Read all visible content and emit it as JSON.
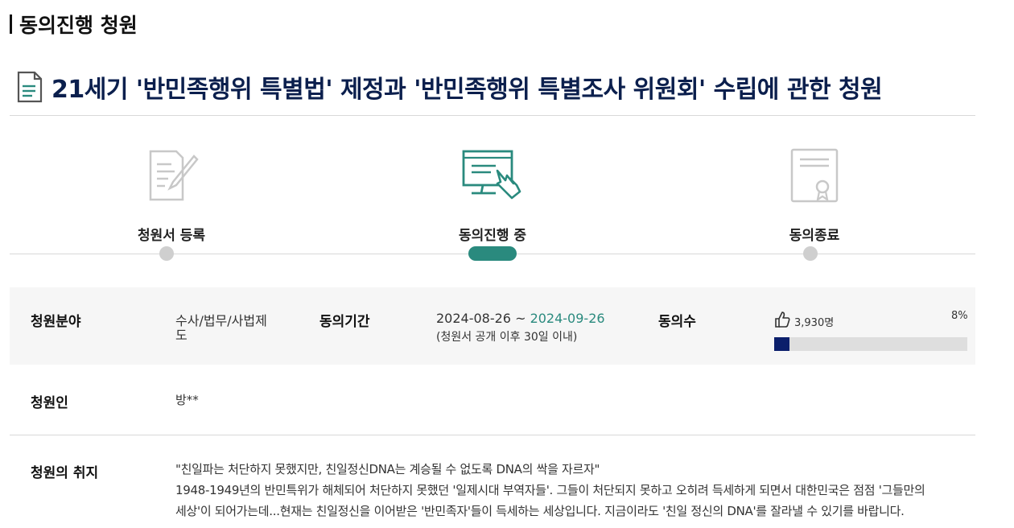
{
  "section": {
    "title": "동의진행 청원"
  },
  "petition": {
    "title": "21세기 '반민족행위 특별법' 제정과 '반민족행위 특별조사 위원회' 수립에 관한 청원"
  },
  "steps": [
    {
      "label": "청원서 등록",
      "icon": "document-pen-icon",
      "state": "done"
    },
    {
      "label": "동의진행 중",
      "icon": "monitor-touch-icon",
      "state": "active"
    },
    {
      "label": "동의종료",
      "icon": "certificate-icon",
      "state": "pending"
    }
  ],
  "colors": {
    "accent": "#2a8a7e",
    "title_navy": "#0b1f4d",
    "progress_navy": "#0b1f6b",
    "band_bg": "#f6f6f6"
  },
  "info": {
    "field_label": "청원분야",
    "field_value_line1": "수사/법무/사법제",
    "field_value_line2": "도",
    "period_label": "동의기간",
    "period_start": "2024-08-26",
    "period_sep": " ~ ",
    "period_end": "2024-09-26",
    "period_note": "(청원서 공개 이후 30일 이내)",
    "count_label": "동의수",
    "count_value": "3,930명",
    "percent_text": "8%",
    "progress_fraction": 0.08
  },
  "petitioner": {
    "label": "청원인",
    "value": "방**"
  },
  "purpose": {
    "label": "청원의 취지",
    "lines": [
      "\"친일파는 처단하지 못했지만, 친일정신DNA는 계승될 수 없도록 DNA의 싹을 자르자\"",
      "1948-1949년의 반민특위가 해체되어 처단하지 못했던 '일제시대 부역자들'. 그들이 처단되지 못하고 오히려 득세하게 되면서 대한민국은 점점 '그들만의",
      "세상'이 되어가는데...현재는 친일정신을 이어받은 '반민족자'들이 득세하는 세상입니다. 지금이라도 '친일 정신의 DNA'를 잘라낼 수 있기를 바랍니다."
    ]
  }
}
